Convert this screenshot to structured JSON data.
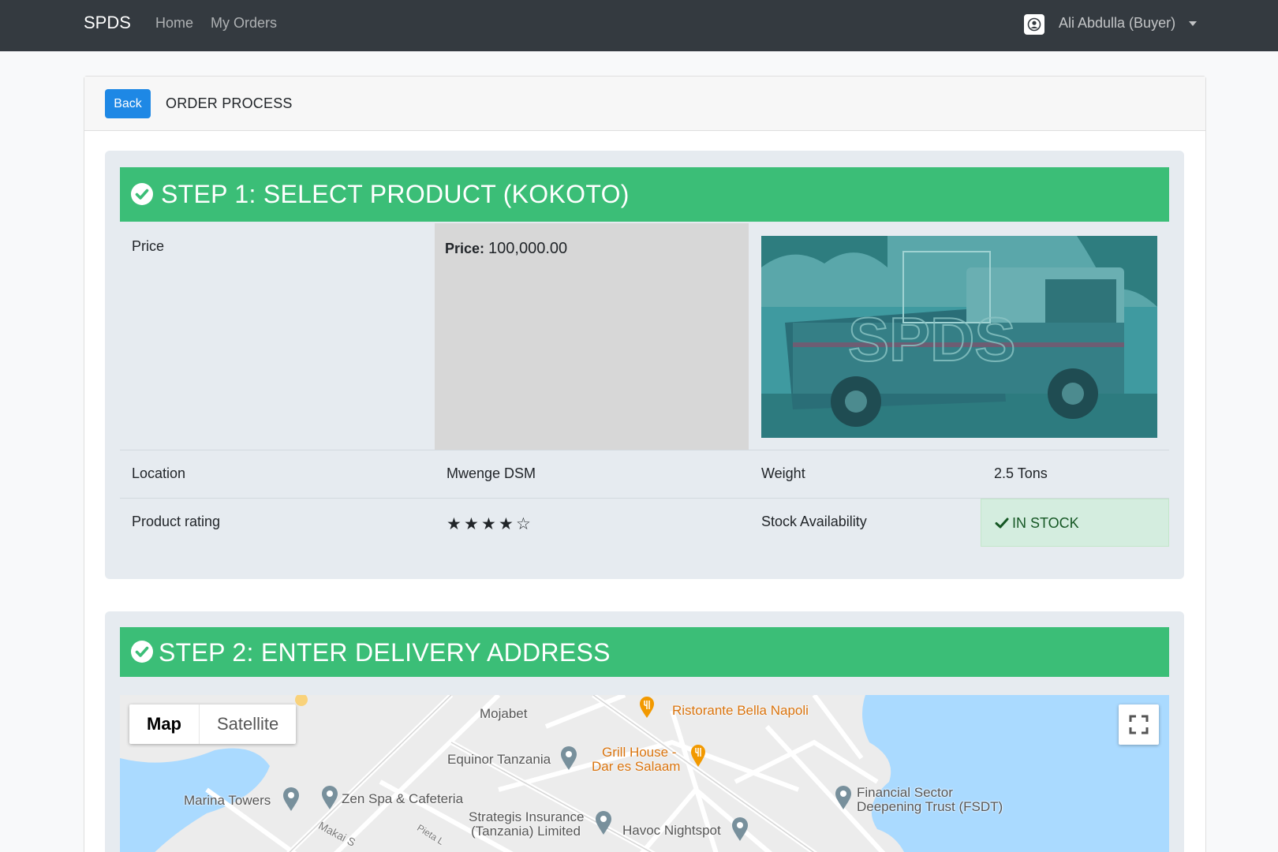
{
  "navbar": {
    "brand": "SPDS",
    "links": [
      "Home",
      "My Orders"
    ],
    "user": "Ali Abdulla (Buyer)"
  },
  "header": {
    "back_label": "Back",
    "title": "ORDER PROCESS"
  },
  "step1": {
    "title": "STEP 1: SELECT PRODUCT (KOKOTO)",
    "price_label": "Price",
    "price_prefix": "Price:",
    "price_value": "100,000.00",
    "image_watermark": "SPDS",
    "location_label": "Location",
    "location_value": "Mwenge DSM",
    "weight_label": "Weight",
    "weight_value": "2.5 Tons",
    "rating_label": "Product rating",
    "rating_value": 4,
    "rating_max": 5,
    "stock_label": "Stock Availability",
    "stock_value": "IN STOCK"
  },
  "step2": {
    "title": "STEP 2: ENTER DELIVERY ADDRESS",
    "map": {
      "toggle_map": "Map",
      "toggle_satellite": "Satellite",
      "places": [
        "Mojabet",
        "Ristorante Bella Napoli",
        "Equinor Tanzania",
        "Grill House -",
        "Dar es Salaam",
        "Marina Towers",
        "Zen Spa & Cafeteria",
        "Financial Sector",
        "Deepening Trust (FSDT)",
        "Strategis Insurance",
        "(Tanzania) Limited",
        "Havoc Nightspot"
      ],
      "streets": [
        "Makai S",
        "Pieta L"
      ]
    }
  },
  "colors": {
    "navbar": "#343a40",
    "step_header": "#3bbe77",
    "back_button": "#1e88e5",
    "stock_bg": "#d4eddf",
    "map_water": "#aadaff"
  }
}
